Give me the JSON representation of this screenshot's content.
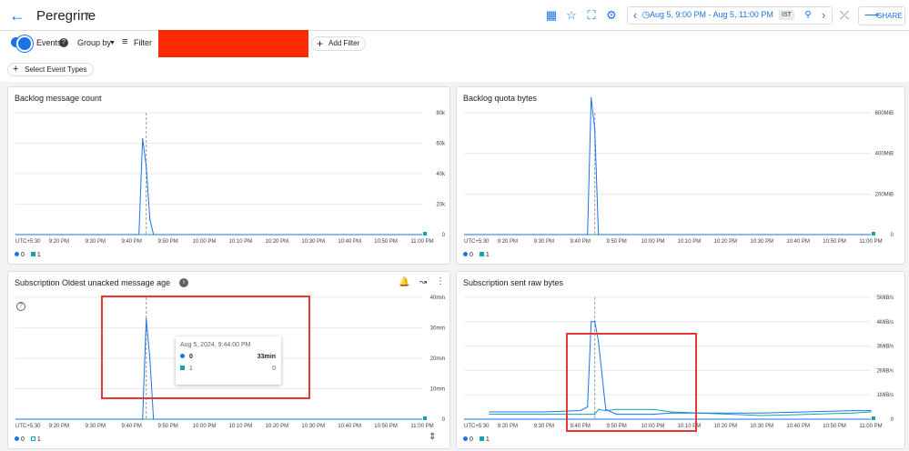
{
  "header": {
    "title": "Peregrine",
    "time_range": "Aug 5, 9:00 PM - Aug 5, 11:00 PM",
    "timezone": "IST",
    "share_label": "SHARE"
  },
  "filters": {
    "events_label": "Events",
    "group_by_label": "Group by",
    "filter_label": "Filter",
    "add_filter_label": "Add Filter",
    "select_event_types_label": "Select Event Types"
  },
  "colors": {
    "accent": "#1a73e8",
    "series_0": "#1a73e8",
    "series_1": "#12a4af",
    "highlight_box": "#e53935",
    "redaction": "#ff2a00"
  },
  "x_ticks": [
    "UTC+5:30",
    "9:20 PM",
    "9:30 PM",
    "9:40 PM",
    "9:50 PM",
    "10:00 PM",
    "10:10 PM",
    "10:20 PM",
    "10:30 PM",
    "10:40 PM",
    "10:50 PM",
    "11:00 PM"
  ],
  "legend": {
    "s0": "0",
    "s1": "1"
  },
  "charts": {
    "backlog_count": {
      "title": "Backlog message count",
      "y_ticks": [
        "80k",
        "60k",
        "40k",
        "20k",
        "0"
      ]
    },
    "backlog_bytes": {
      "title": "Backlog quota bytes",
      "y_ticks": [
        "600MiB",
        "400MiB",
        "200MiB",
        "0"
      ]
    },
    "oldest_unacked": {
      "title": "Subscription Oldest unacked message age",
      "y_ticks": [
        "40min",
        "30min",
        "20min",
        "10min",
        "0"
      ],
      "tooltip": {
        "time": "Aug 5, 2024, 9:44:00 PM",
        "row0_label": "0",
        "row0_value": "33min",
        "row1_label": "1",
        "row1_value": "0"
      }
    },
    "sent_raw_bytes": {
      "title": "Subscription sent raw bytes",
      "y_ticks": [
        "5MiB/s",
        "4MiB/s",
        "3MiB/s",
        "2MiB/s",
        "1MiB/s",
        "0"
      ]
    }
  },
  "chart_data": [
    {
      "type": "line",
      "title": "Backlog message count",
      "x": [
        "9:41 PM",
        "9:42 PM",
        "9:43 PM",
        "9:44 PM",
        "9:45 PM",
        "9:46 PM"
      ],
      "series": [
        {
          "name": "0",
          "values": [
            0,
            0,
            63000,
            45000,
            10000,
            0
          ]
        },
        {
          "name": "1",
          "values": [
            0,
            0,
            0,
            0,
            0,
            0
          ]
        }
      ],
      "ylim": [
        0,
        80000
      ]
    },
    {
      "type": "line",
      "title": "Backlog quota bytes",
      "x": [
        "9:41 PM",
        "9:42 PM",
        "9:43 PM",
        "9:44 PM",
        "9:45 PM",
        "9:46 PM"
      ],
      "series": [
        {
          "name": "0",
          "values": [
            0,
            0,
            730,
            560,
            0,
            0
          ]
        },
        {
          "name": "1",
          "values": [
            0,
            0,
            0,
            0,
            0,
            0
          ]
        }
      ],
      "ylim": [
        0,
        650
      ]
    },
    {
      "type": "line",
      "title": "Subscription Oldest unacked message age",
      "x": [
        "9:43 PM",
        "9:44 PM",
        "9:45 PM",
        "9:46 PM"
      ],
      "series": [
        {
          "name": "0",
          "values": [
            0,
            33,
            20,
            0
          ]
        },
        {
          "name": "1",
          "values": [
            0,
            0,
            0,
            0
          ]
        }
      ],
      "ylim": [
        0,
        40
      ]
    },
    {
      "type": "line",
      "title": "Subscription sent raw bytes",
      "x": [
        "9:15 PM",
        "9:30 PM",
        "9:40 PM",
        "9:42 PM",
        "9:43 PM",
        "9:44 PM",
        "9:45 PM",
        "9:47 PM",
        "9:50 PM",
        "10:00 PM",
        "10:05 PM",
        "10:30 PM",
        "10:55 PM",
        "11:00 PM"
      ],
      "series": [
        {
          "name": "0",
          "values": [
            0.3,
            0.3,
            0.35,
            0.5,
            4.0,
            4.0,
            3.2,
            0.4,
            0.2,
            0.2,
            0.25,
            0.25,
            0.35,
            0.35
          ]
        },
        {
          "name": "1",
          "values": [
            0.2,
            0.2,
            0.2,
            0.2,
            0.2,
            0.2,
            0.4,
            0.35,
            0.4,
            0.4,
            0.3,
            0.15,
            0.25,
            0.3
          ]
        }
      ],
      "ylim": [
        0,
        5
      ]
    }
  ]
}
